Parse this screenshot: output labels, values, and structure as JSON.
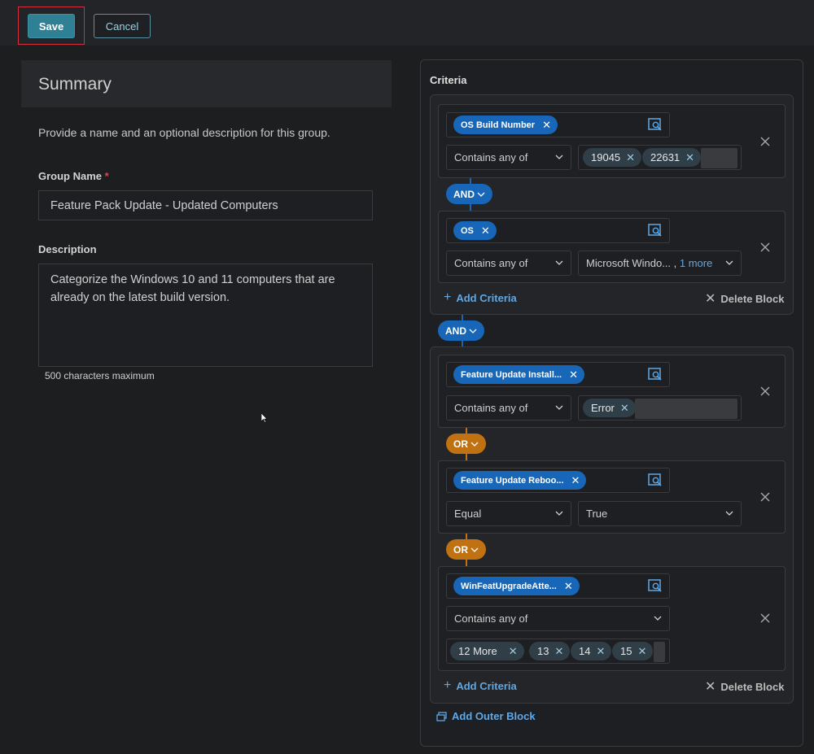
{
  "toolbar": {
    "save_label": "Save",
    "cancel_label": "Cancel"
  },
  "summary": {
    "title": "Summary",
    "intro": "Provide a name and an optional description for this group.",
    "group_name_label": "Group Name",
    "group_name_required": "*",
    "group_name_value": "Feature Pack Update - Updated Computers",
    "description_label": "Description",
    "description_value": "Categorize the Windows 10 and 11 computers that are already on the latest build version.",
    "description_hint": "500 characters maximum"
  },
  "criteria": {
    "title": "Criteria",
    "block1": {
      "row1": {
        "field": "OS Build Number",
        "operator": "Contains any of",
        "values": [
          "19045",
          "22631"
        ]
      },
      "connector": "AND",
      "row2": {
        "field": "OS",
        "operator": "Contains any of",
        "value_text": "Microsoft Windo... ,",
        "value_more": "1 more"
      },
      "add_label": "Add Criteria",
      "delete_label": "Delete Block"
    },
    "outer_connector": "AND",
    "block2": {
      "row1": {
        "field": "Feature Update Install...",
        "operator": "Contains any of",
        "values": [
          "Error"
        ]
      },
      "connector1": "OR",
      "row2": {
        "field": "Feature Update Reboo...",
        "operator": "Equal",
        "value": "True"
      },
      "connector2": "OR",
      "row3": {
        "field": "WinFeatUpgradeAtte...",
        "operator": "Contains any of",
        "values": [
          "12 More",
          "13",
          "14",
          "15"
        ]
      },
      "add_label": "Add Criteria",
      "delete_label": "Delete Block"
    },
    "add_outer_label": "Add Outer Block"
  },
  "colors": {
    "accent": "#1766b8",
    "or_connector": "#c07112",
    "save": "#2f7f95"
  },
  "icons": [
    "field-picker-icon",
    "close-icon",
    "chevron-down-icon",
    "plus-icon",
    "outer-block-icon"
  ]
}
